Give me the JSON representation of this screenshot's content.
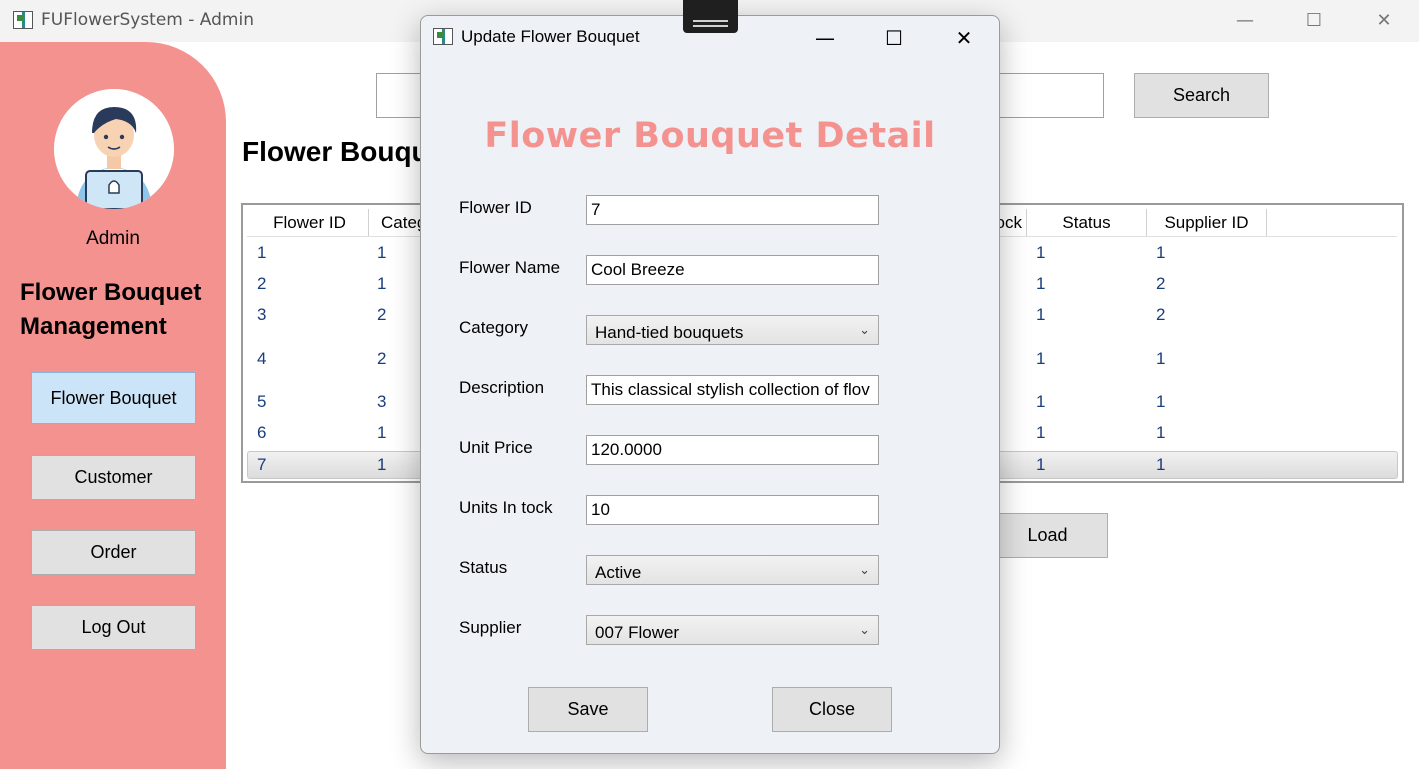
{
  "window": {
    "title": "FUFlowerSystem - Admin",
    "minimize": "—",
    "maximize": "☐",
    "close": "✕"
  },
  "sidebar": {
    "username": "Admin",
    "title_line1": "Flower Bouquet",
    "title_line2": "Management",
    "nav": [
      {
        "label": "Flower Bouquet",
        "active": true
      },
      {
        "label": "Customer"
      },
      {
        "label": "Order"
      },
      {
        "label": "Log Out"
      }
    ]
  },
  "main": {
    "search_value": "",
    "search_button": "Search",
    "page_title_visible": "Flower Bouqu",
    "load_button": "Load",
    "grid": {
      "headers_visible": [
        "Flower ID",
        "Categ",
        "ock",
        "Status",
        "Supplier ID"
      ],
      "rows": [
        {
          "flower_id": "1",
          "category": "1",
          "stock": "1",
          "supplier_id": "1"
        },
        {
          "flower_id": "2",
          "category": "1",
          "stock": "1",
          "supplier_id": "2"
        },
        {
          "flower_id": "3",
          "category": "2",
          "stock": "1",
          "supplier_id": "2"
        },
        {
          "flower_id": "4",
          "category": "2",
          "stock": "1",
          "supplier_id": "1"
        },
        {
          "flower_id": "5",
          "category": "3",
          "stock": "1",
          "supplier_id": "1"
        },
        {
          "flower_id": "6",
          "category": "1",
          "stock": "1",
          "supplier_id": "1"
        },
        {
          "flower_id": "7",
          "category": "1",
          "stock": "1",
          "supplier_id": "1"
        }
      ],
      "selected_row_index": 6
    }
  },
  "dialog": {
    "title": "Update Flower Bouquet",
    "minimize": "—",
    "maximize": "☐",
    "close": "✕",
    "heading": "Flower Bouquet Detail",
    "fields": {
      "flower_id": {
        "label": "Flower ID",
        "value": "7"
      },
      "flower_name": {
        "label": "Flower Name",
        "value": "Cool Breeze"
      },
      "category": {
        "label": "Category",
        "value": "Hand-tied bouquets"
      },
      "description": {
        "label": "Description",
        "value": "This classical stylish collection of flov"
      },
      "unit_price": {
        "label": "Unit Price",
        "value": "120.0000"
      },
      "units_in_stock": {
        "label": "Units In tock",
        "value": "10"
      },
      "status": {
        "label": "Status",
        "value": "Active"
      },
      "supplier": {
        "label": "Supplier",
        "value": "007 Flower"
      }
    },
    "save_button": "Save",
    "close_button": "Close",
    "chevron": "⌄"
  },
  "colors": {
    "sidebar_bg": "#f4928f",
    "heading": "#f4928f",
    "active_nav": "#cce4f7",
    "cell_text": "#1a3d7c"
  }
}
